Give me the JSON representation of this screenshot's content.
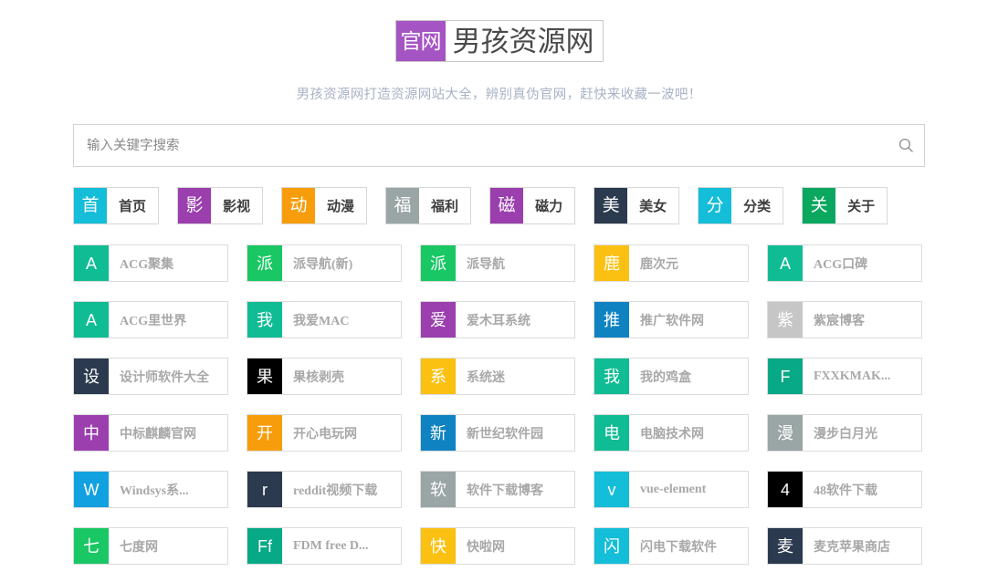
{
  "header": {
    "logo_badge": "官网",
    "logo_title": "男孩资源网",
    "logo_badge_color": "#a554c4",
    "subtitle": "男孩资源网打造资源网站大全，辨别真伪官网，赶快来收藏一波吧！"
  },
  "search": {
    "placeholder": "输入关键字搜索",
    "value": "",
    "icon": "search-icon"
  },
  "nav": {
    "items": [
      {
        "icon": "首",
        "label": "首页",
        "color": "#14bdd8"
      },
      {
        "icon": "影",
        "label": "影视",
        "color": "#9b3eae"
      },
      {
        "icon": "动",
        "label": "动漫",
        "color": "#f79d0b"
      },
      {
        "icon": "福",
        "label": "福利",
        "color": "#9aa5a5"
      },
      {
        "icon": "磁",
        "label": "磁力",
        "color": "#9b3eae"
      },
      {
        "icon": "美",
        "label": "美女",
        "color": "#2b3a4e"
      },
      {
        "icon": "分",
        "label": "分类",
        "color": "#14bdd8"
      },
      {
        "icon": "关",
        "label": "关于",
        "color": "#0aa75f"
      }
    ]
  },
  "grid": {
    "cards": [
      {
        "icon": "A",
        "label": "ACG聚集",
        "color": "#10bc94"
      },
      {
        "icon": "派",
        "label": "派导航(新)",
        "color": "#19c764"
      },
      {
        "icon": "派",
        "label": "派导航",
        "color": "#19c764"
      },
      {
        "icon": "鹿",
        "label": "鹿次元",
        "color": "#fac112"
      },
      {
        "icon": "A",
        "label": "ACG口碑",
        "color": "#10bc94"
      },
      {
        "icon": "A",
        "label": "ACG里世界",
        "color": "#10bc94"
      },
      {
        "icon": "我",
        "label": "我爱MAC",
        "color": "#10bc94"
      },
      {
        "icon": "爱",
        "label": "爱木耳系统",
        "color": "#9b3eae"
      },
      {
        "icon": "推",
        "label": "推广软件网",
        "color": "#0f82c1"
      },
      {
        "icon": "紫",
        "label": "紫宸博客",
        "color": "#c6c6c6"
      },
      {
        "icon": "设",
        "label": "设计师软件大全",
        "color": "#2b3a4e"
      },
      {
        "icon": "果",
        "label": "果核剥壳",
        "color": "#000000"
      },
      {
        "icon": "系",
        "label": "系统迷",
        "color": "#fac112"
      },
      {
        "icon": "我",
        "label": "我的鸡盒",
        "color": "#10bc94"
      },
      {
        "icon": "F",
        "label": "FXXKMAK...",
        "color": "#07a986"
      },
      {
        "icon": "中",
        "label": "中标麒麟官网",
        "color": "#9b3eae"
      },
      {
        "icon": "开",
        "label": "开心电玩网",
        "color": "#f79d0b"
      },
      {
        "icon": "新",
        "label": "新世纪软件园",
        "color": "#0f82c1"
      },
      {
        "icon": "电",
        "label": "电脑技术网",
        "color": "#10bc94"
      },
      {
        "icon": "漫",
        "label": "漫步白月光",
        "color": "#9aa5a5"
      },
      {
        "icon": "W",
        "label": "Windsys系...",
        "color": "#12a1e0"
      },
      {
        "icon": "r",
        "label": "reddit视频下载",
        "color": "#2b3a4e"
      },
      {
        "icon": "软",
        "label": "软件下载博客",
        "color": "#9aa5a5"
      },
      {
        "icon": "v",
        "label": "vue-element",
        "color": "#14bdd8"
      },
      {
        "icon": "4",
        "label": "48软件下载",
        "color": "#000000"
      },
      {
        "icon": "七",
        "label": "七度网",
        "color": "#19c764"
      },
      {
        "icon": "Ff",
        "label": "FDM free D...",
        "color": "#07a986"
      },
      {
        "icon": "快",
        "label": "快啦网",
        "color": "#fac112"
      },
      {
        "icon": "闪",
        "label": "闪电下载软件",
        "color": "#14bdd8"
      },
      {
        "icon": "麦",
        "label": "麦克苹果商店",
        "color": "#2b3a4e"
      }
    ]
  }
}
